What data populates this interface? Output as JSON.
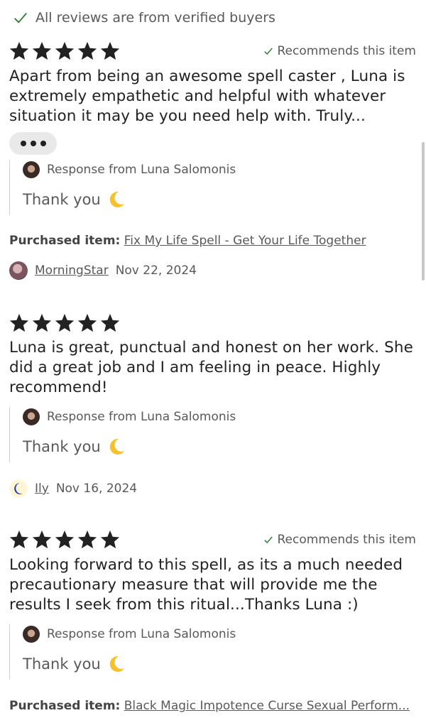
{
  "header": {
    "verified_text": "All reviews are from verified buyers"
  },
  "reviews": [
    {
      "rating": 5,
      "recommends": "Recommends this item",
      "text": "Apart from being an awesome spell caster , Luna is extremely empathetic and helpful with whatever situation it may be you need help with. Truly...",
      "response_from": "Response from Luna Salomonis",
      "response_text": "Thank you",
      "purchased_label": "Purchased item:",
      "purchased_item": "Fix My Life Spell - Get Your Life Together",
      "reviewer": "MorningStar",
      "date": "Nov 22, 2024"
    },
    {
      "rating": 5,
      "text": "Luna is great, punctual and honest on her work. She did a great job and I am feeling in peace. Highly recommend!",
      "response_from": "Response from Luna Salomonis",
      "response_text": "Thank you",
      "reviewer": "Ily",
      "date": "Nov 16, 2024"
    },
    {
      "rating": 5,
      "recommends": "Recommends this item",
      "text": "Looking forward to this spell, as its a much needed precautionary measure that will provide me the results I seek from this ritual...Thanks Luna :)",
      "response_from": "Response from Luna Salomonis",
      "response_text": "Thank you",
      "purchased_label": "Purchased item:",
      "purchased_item": "Black Magic Impotence Curse Sexual Perform..."
    }
  ],
  "icons": {
    "check": "check-icon",
    "star": "star-icon",
    "more": "more-horizontal-icon",
    "moon": "crescent-moon-emoji"
  },
  "colors": {
    "star": "#222222",
    "check": "#2e7d32",
    "muted_text": "#595959",
    "moon": "#f6c12b"
  }
}
